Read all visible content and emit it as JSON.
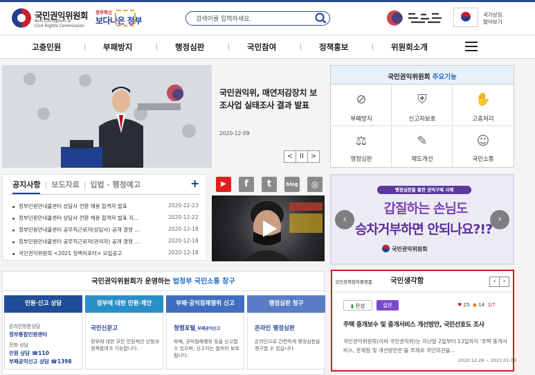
{
  "header": {
    "org_name": "국민권익위원회",
    "org_name_en_1": "Anti-Corruption &",
    "org_name_en_2": "Civil Rights Commission",
    "gov_slogan_sub": "정부혁신",
    "gov_slogan_main": "보다나은 정부",
    "search_placeholder": "검색어를 입력하세요.",
    "right_logo_alt": "국민의 나라 정의로운 대한민국",
    "flag_label_1": "국가상징",
    "flag_label_2": "알아보기"
  },
  "nav": {
    "items": [
      "고충민원",
      "부패방지",
      "행정심판",
      "국민참여",
      "정책홍보",
      "위원회소개"
    ]
  },
  "news": {
    "title": "국민권익위, 매연저감장치 보조사업 실태조사 결과 발표",
    "date": "2020-12-09",
    "controls": [
      "<",
      "II",
      ">"
    ]
  },
  "functions": {
    "title_prefix": "국민권익위원회",
    "title_accent": "주요기능",
    "items": [
      {
        "label": "부패방지",
        "icon": "no-entry-icon"
      },
      {
        "label": "신고자보호",
        "icon": "shield-icon"
      },
      {
        "label": "고충처리",
        "icon": "handshake-icon"
      },
      {
        "label": "행정심판",
        "icon": "gavel-icon"
      },
      {
        "label": "제도개선",
        "icon": "document-edit-icon"
      },
      {
        "label": "국민소통",
        "icon": "people-chat-icon"
      }
    ]
  },
  "notice": {
    "tabs": [
      "공지사항",
      "보도자료",
      "입법 · 행정예고"
    ],
    "rows": [
      {
        "title": "정부민원안내콜센터 상담사 전환 채용 합격자 발표",
        "date": "2020-12-23"
      },
      {
        "title": "정부민원안내콜센터 상담사 전환 채용 합격자 발표 지...",
        "date": "2020-12-22"
      },
      {
        "title": "정부민원안내콜센터 공무직근로자(상담사) 공개 경쟁 ...",
        "date": "2020-12-18"
      },
      {
        "title": "정부민원안내콜센터 공무직근로자(관리자) 공개 경쟁 ...",
        "date": "2020-12-18"
      },
      {
        "title": "국민권익위원회 <2021 청백리포터> 모집공고",
        "date": "2020-12-18"
      }
    ]
  },
  "social": {
    "items": [
      {
        "name": "youtube-icon",
        "glyph": "▶",
        "color": "#e02020"
      },
      {
        "name": "facebook-icon",
        "glyph": "f",
        "color": "#8a8a8a"
      },
      {
        "name": "twitter-icon",
        "glyph": "t",
        "color": "#8a8a8a"
      },
      {
        "name": "blog-icon",
        "glyph": "blog",
        "color": "#8a8a8a"
      },
      {
        "name": "instagram-icon",
        "glyph": "◎",
        "color": "#8a8a8a"
      }
    ]
  },
  "banner": {
    "pill": "행정심판을 통한 권익구제 사례",
    "line1": "갑질하는 손님도",
    "line2": "승차거부하면 안되나요?!?",
    "logo_text": "국민권익위원회"
  },
  "channels": {
    "title_prefix": "국민권익위원회가 운영하는",
    "title_accent": "법정부 국민소통 창구",
    "columns": [
      {
        "head": "민원·신고 상담",
        "color": "#1f4e96",
        "lines": [
          "온라인방문상담",
          "정부통합민원센터",
          "전화 상담",
          "민원 상담 ☎110",
          "부패공익신고 상담 ☎1398"
        ]
      },
      {
        "head": "정부에 대한 민원·제안",
        "color": "#2a8fc7",
        "link": "국민신문고",
        "desc": "정부에 대한 모든 민원제안 신청과 정책참여가 가능합니다."
      },
      {
        "head": "부패·공익침해행위 신고",
        "color": "#3f6fc0",
        "link": "청렴포털",
        "link_suffix": "_부패공익신고",
        "desc": "부패, 공익침해행위 등을 신고할 수 있으며, 신고자는 철저히 보호됩니다."
      },
      {
        "head": "행정심판 청구",
        "color": "#5a7cc4",
        "link": "온라인 행정심판",
        "desc": "온라인으로 간편하게 행정심판을 청구할 수 있습니다."
      }
    ]
  },
  "thought": {
    "subtitle": "국민정책참여플랫폼",
    "title": "국민생각함",
    "badge_1": "찬성",
    "badge_2": "설문",
    "likes": "25",
    "comments": "14",
    "page": "2/7",
    "question": "주택 중개보수 및 중개서비스 개선방안, 국민선호도 조사",
    "desc": "국민권익위원회(이하 국민권익위)는 지난달 2일부터 13일까지 '주택 중개서비스, 문제점 및 개선방안은'을 주제로 국민의견을...",
    "date_range": "2020.12.28 ~ 2021.01.08"
  },
  "colors": {
    "brand_navy": "#1f3f8f",
    "accent_blue": "#1f6dc4",
    "highlight_red": "#d7161e"
  }
}
